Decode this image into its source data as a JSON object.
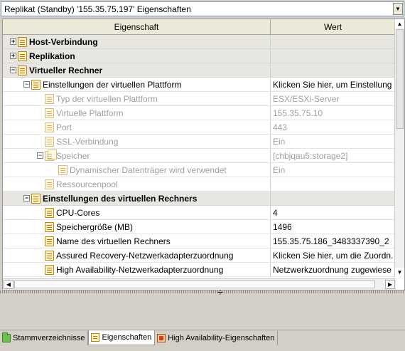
{
  "title_bar": {
    "text": "Replikat (Standby) '155.35.75.197' Eigenschaften",
    "dropdown_arrow": "▼"
  },
  "grid": {
    "headers": {
      "property": "Eigenschaft",
      "value": "Wert"
    },
    "rows": [
      {
        "label": "Host-Verbindung",
        "value": "",
        "expander": "+"
      },
      {
        "label": "Replikation",
        "value": "",
        "expander": "+"
      },
      {
        "label": "Virtueller Rechner",
        "value": "",
        "expander": "−"
      },
      {
        "label": "Einstellungen der virtuellen Plattform",
        "value": "Klicken Sie hier, um Einstellung",
        "expander": "−"
      },
      {
        "label": "Typ der virtuellen Plattform",
        "value": "ESX/ESXi-Server"
      },
      {
        "label": "Virtuelle Plattform",
        "value": "155.35.75.10"
      },
      {
        "label": "Port",
        "value": "443"
      },
      {
        "label": "SSL-Verbindung",
        "value": "Ein"
      },
      {
        "label": "Speicher",
        "value": "[chbjqau5:storage2]",
        "expander": "−"
      },
      {
        "label": "Dynamischer Datenträger wird verwendet",
        "value": "Ein"
      },
      {
        "label": "Ressourcenpool",
        "value": ""
      },
      {
        "label": "Einstellungen des virtuellen Rechners",
        "value": "",
        "expander": "−"
      },
      {
        "label": "CPU-Cores",
        "value": "4"
      },
      {
        "label": "Speichergröße (MB)",
        "value": "1496"
      },
      {
        "label": "Name des virtuellen Rechners",
        "value": "155.35.75.186_3483337390_2"
      },
      {
        "label": "Assured Recovery-Netzwerkadapterzuordnung",
        "value": "Klicken Sie hier, um die Zuordn."
      },
      {
        "label": "High Availability-Netzwerkadapterzuordnung",
        "value": "Netzwerkzuordnung zugewiese"
      }
    ]
  },
  "scrollbars": {
    "up": "▲",
    "down": "▼",
    "left": "◀",
    "right": "▶"
  },
  "splitter_glyph": "÷",
  "tabs": [
    {
      "label": "Stammverzeichnisse",
      "icon": "folder-icon"
    },
    {
      "label": "Eigenschaften",
      "icon": "properties-icon",
      "active": true
    },
    {
      "label": "High Availability-Eigenschaften",
      "icon": "high-availability-icon"
    }
  ]
}
